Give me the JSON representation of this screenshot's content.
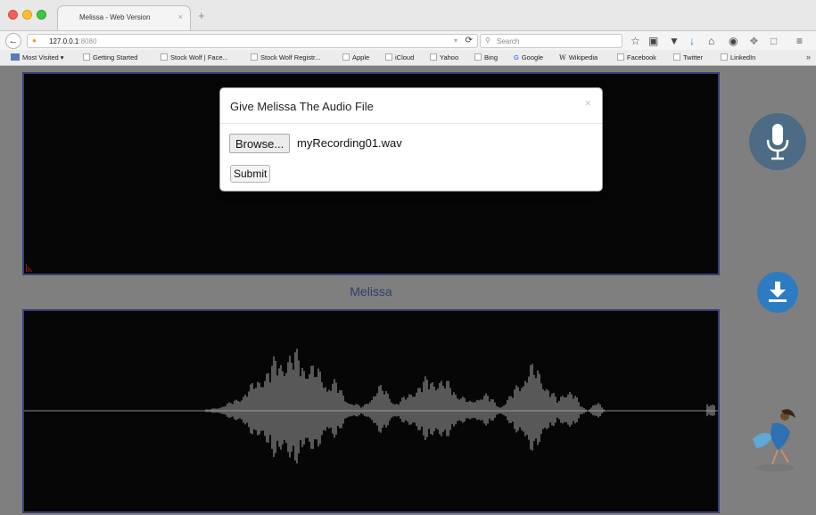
{
  "browser": {
    "tab_title": "Melissa - Web Version",
    "tab_close": "×",
    "new_tab": "+",
    "url_host": "127.0.0.1",
    "url_port": ":8080",
    "search_placeholder": "Search",
    "toolbar_icons": [
      "star-icon",
      "reading-list-icon",
      "pocket-icon",
      "download-icon",
      "home-icon",
      "chat-icon",
      "shield-icon",
      "sidebar-icon",
      "menu-icon"
    ]
  },
  "bookmarks": {
    "most_visited": "Most Visited ▾",
    "items": [
      "Getting Started",
      "Stock Wolf | Face...",
      "Stock Wolf Registr...",
      "Apple",
      "iCloud",
      "Yahoo",
      "Bing",
      "Google",
      "Wikipedia",
      "Facebook",
      "Twitter",
      "LinkedIn"
    ],
    "overflow": "»"
  },
  "page": {
    "label": "Melissa"
  },
  "modal": {
    "title": "Give Melissa The Audio File",
    "close": "×",
    "browse_label": "Browse...",
    "file_name": "myRecording01.wav",
    "submit_label": "Submit"
  },
  "colors": {
    "accent_mic": "#4d6b84",
    "accent_download": "#2d7cc2",
    "waveform": "#a9a9a9"
  }
}
